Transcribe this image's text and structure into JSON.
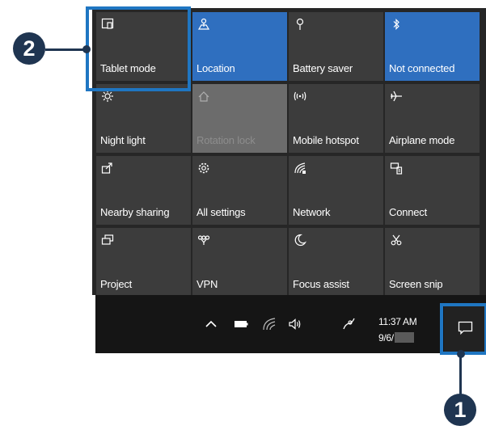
{
  "action_center": {
    "tiles": [
      {
        "label": "Tablet mode",
        "icon": "tablet-mode-icon",
        "state": "off"
      },
      {
        "label": "Location",
        "icon": "location-icon",
        "state": "on"
      },
      {
        "label": "Battery saver",
        "icon": "battery-saver-icon",
        "state": "off"
      },
      {
        "label": "Not connected",
        "icon": "bluetooth-icon",
        "state": "on"
      },
      {
        "label": "Night light",
        "icon": "night-light-icon",
        "state": "off"
      },
      {
        "label": "Rotation lock",
        "icon": "rotation-lock-icon",
        "state": "disabled"
      },
      {
        "label": "Mobile hotspot",
        "icon": "mobile-hotspot-icon",
        "state": "off"
      },
      {
        "label": "Airplane mode",
        "icon": "airplane-mode-icon",
        "state": "off"
      },
      {
        "label": "Nearby sharing",
        "icon": "nearby-sharing-icon",
        "state": "off"
      },
      {
        "label": "All settings",
        "icon": "settings-gear-icon",
        "state": "off"
      },
      {
        "label": "Network",
        "icon": "network-icon",
        "state": "off"
      },
      {
        "label": "Connect",
        "icon": "connect-icon",
        "state": "off"
      },
      {
        "label": "Project",
        "icon": "project-icon",
        "state": "off"
      },
      {
        "label": "VPN",
        "icon": "vpn-icon",
        "state": "off"
      },
      {
        "label": "Focus assist",
        "icon": "focus-assist-icon",
        "state": "off"
      },
      {
        "label": "Screen snip",
        "icon": "screen-snip-icon",
        "state": "off"
      }
    ]
  },
  "taskbar": {
    "time": "11:37 AM",
    "date": "9/6/",
    "tray_icons": [
      "chevron-up-icon",
      "battery-icon",
      "wifi-icon",
      "volume-icon",
      "pen-icon"
    ],
    "action_center_button_icon": "notification-icon"
  },
  "callouts": {
    "tablet_mode_marker": "2",
    "action_center_marker": "1"
  },
  "colors": {
    "tile_active": "#2f6fbf",
    "tile_inactive": "#3c3c3c",
    "tile_disabled": "#6c6c6c",
    "callout_box": "#1f76c2",
    "callout_marker": "#1f3551"
  }
}
